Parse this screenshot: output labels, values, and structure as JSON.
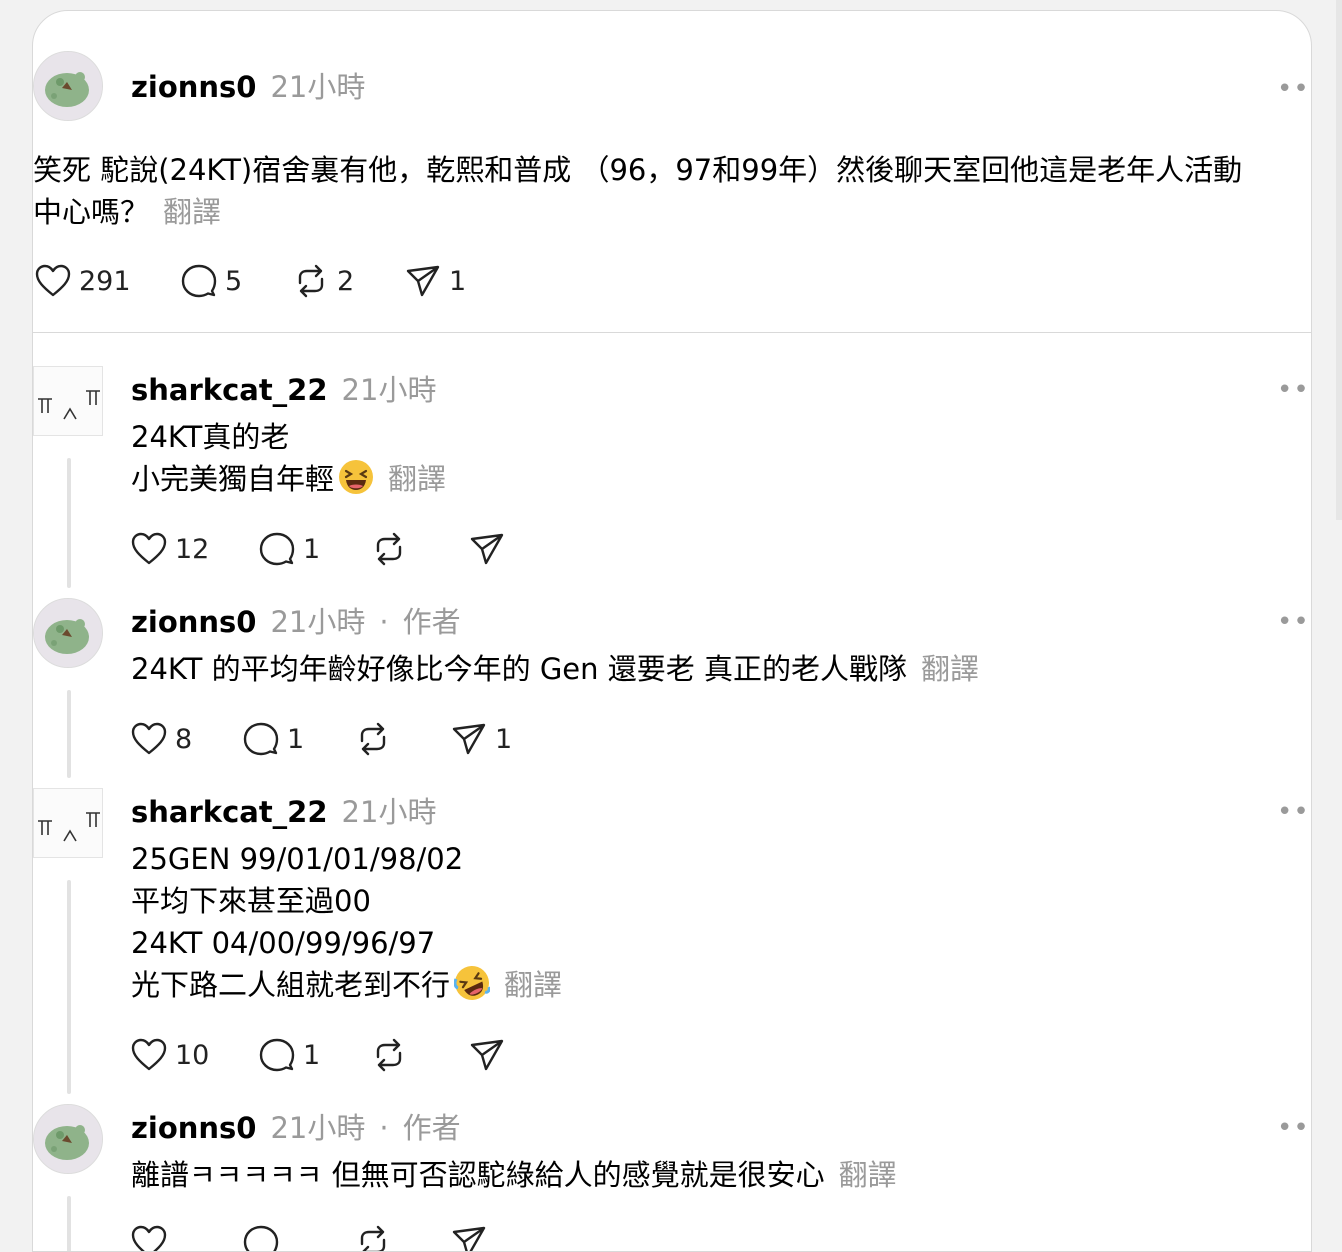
{
  "main_post": {
    "username": "zionns0",
    "time": "21小時",
    "text": "笑死 駝說(24KT)宿舍裏有他，乾熙和普成 （96，97和99年）然後聊天室回他這是老年人活動",
    "text_line2": "中心嗎？",
    "translate": "翻譯",
    "likes": "291",
    "comments": "5",
    "reposts": "2",
    "shares": "1"
  },
  "replies": [
    {
      "username": "sharkcat_22",
      "time": "21小時",
      "lines": [
        "24KT真的老",
        "小完美獨自年輕"
      ],
      "emoji": "laughing-face",
      "translate": "翻譯",
      "likes": "12",
      "comments": "1",
      "reposts": "",
      "shares": ""
    },
    {
      "username": "zionns0",
      "time": "21小時",
      "dot": "·",
      "author": "作者",
      "lines": [
        "24KT 的平均年齡好像比今年的 Gen 還要老 真正的老人戰隊"
      ],
      "translate": "翻譯",
      "likes": "8",
      "comments": "1",
      "reposts": "",
      "shares": "1"
    },
    {
      "username": "sharkcat_22",
      "time": "21小時",
      "lines": [
        "25GEN 99/01/01/98/02",
        "平均下來甚至過00",
        "24KT 04/00/99/96/97",
        "光下路二人組就老到不行"
      ],
      "emoji": "rolling-laughing-face",
      "translate": "翻譯",
      "likes": "10",
      "comments": "1",
      "reposts": "",
      "shares": ""
    },
    {
      "username": "zionns0",
      "time": "21小時",
      "dot": "·",
      "author": "作者",
      "lines": [
        "離譜ㅋㅋㅋㅋㅋ 但無可否認駝綠給人的感覺就是很安心"
      ],
      "translate": "翻譯"
    }
  ],
  "icons": {
    "more": "•••",
    "like": "heart-icon",
    "comment": "comment-icon",
    "repost": "repost-icon",
    "share": "send-icon"
  },
  "colors": {
    "muted_text": "#9a9a9a",
    "thread_line": "#e2e2e2",
    "divider": "#d9d9d9"
  }
}
